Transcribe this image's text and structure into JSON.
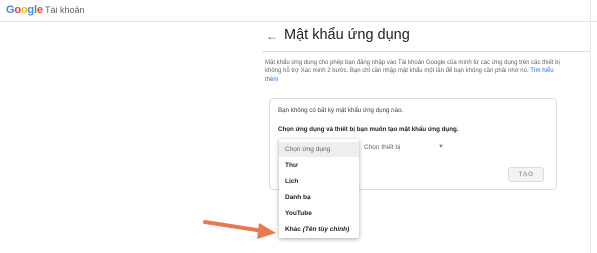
{
  "header": {
    "logo_word": "Google",
    "product": "Tài khoản"
  },
  "title": {
    "text": "Mật khẩu ứng dụng"
  },
  "description": {
    "text": "Mật khẩu ứng dụng cho phép bạn đăng nhập vào Tài khoản Google của mình từ các ứng dụng trên các thiết bị không hỗ trợ Xác minh 2 bước. Bạn chỉ cần nhập mật khẩu một lần để bạn không cần phải nhớ nó.",
    "link": "Tìm hiểu thêm"
  },
  "card": {
    "no_passwords": "Bạn không có bất kỳ mật khẩu ứng dụng nào.",
    "instruction": "Chọn ứng dụng và thiết bị bạn muốn tạo mật khẩu ứng dụng.",
    "device_select": "Chọn thiết bị",
    "create_button": "TẠO"
  },
  "menu": {
    "items": [
      {
        "label": "Chọn ứng dụng",
        "suffix": ""
      },
      {
        "label": "Thư",
        "suffix": ""
      },
      {
        "label": "Lịch",
        "suffix": ""
      },
      {
        "label": "Danh bạ",
        "suffix": ""
      },
      {
        "label": "YouTube",
        "suffix": ""
      },
      {
        "label": "Khác",
        "suffix": "(Tên tùy chỉnh)"
      }
    ],
    "selected_index": 0
  },
  "colors": {
    "annotation_arrow": "#e8794f",
    "link": "#1a73e8"
  }
}
